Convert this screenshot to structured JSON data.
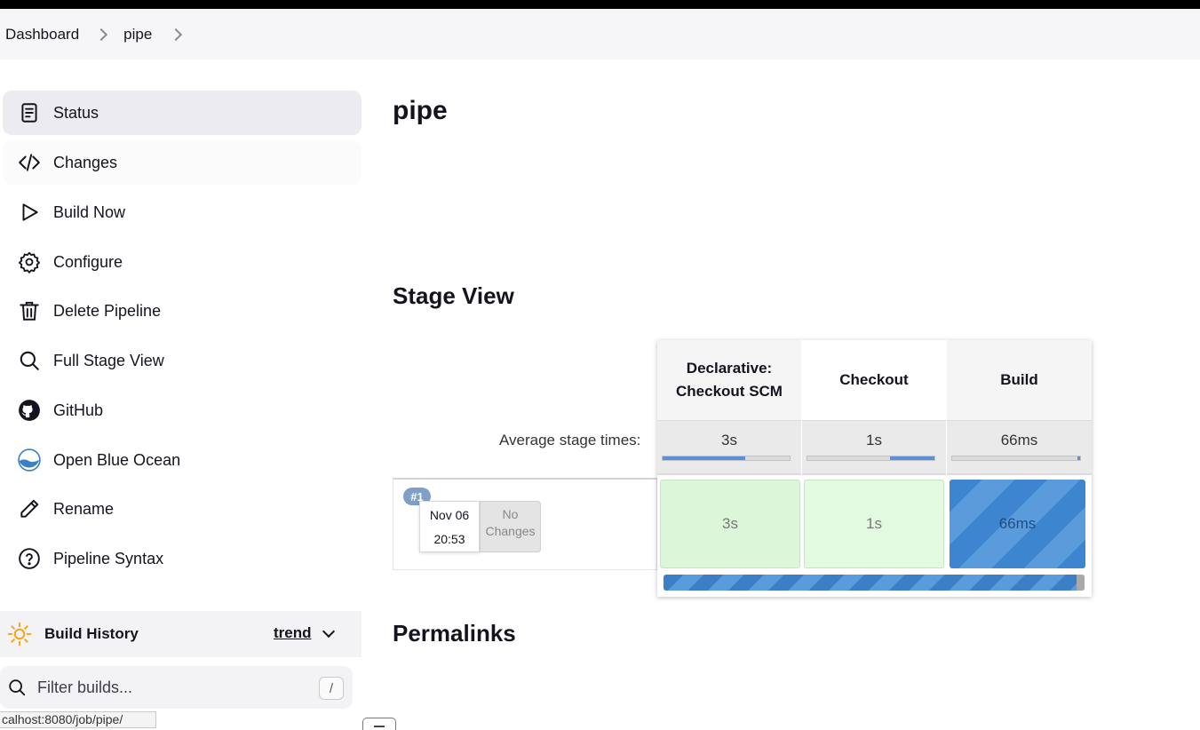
{
  "breadcrumb": {
    "items": [
      "Dashboard",
      "pipe"
    ]
  },
  "sidebar": {
    "items": [
      {
        "label": "Status",
        "icon": "document-icon"
      },
      {
        "label": "Changes",
        "icon": "code-icon"
      },
      {
        "label": "Build Now",
        "icon": "play-icon"
      },
      {
        "label": "Configure",
        "icon": "gear-icon"
      },
      {
        "label": "Delete Pipeline",
        "icon": "trash-icon"
      },
      {
        "label": "Full Stage View",
        "icon": "search-icon"
      },
      {
        "label": "GitHub",
        "icon": "github-icon"
      },
      {
        "label": "Open Blue Ocean",
        "icon": "blue-ocean-icon"
      },
      {
        "label": "Rename",
        "icon": "pencil-icon"
      },
      {
        "label": "Pipeline Syntax",
        "icon": "help-icon"
      }
    ]
  },
  "build_history": {
    "title": "Build History",
    "trend": "trend",
    "filter_placeholder": "Filter builds...",
    "shortcut": "/"
  },
  "status_url": "calhost:8080/job/pipe/",
  "main": {
    "title": "pipe",
    "stage_view_heading": "Stage View",
    "permalinks_heading": "Permalinks",
    "avg_label": "Average stage times:",
    "stages": [
      {
        "name_line1": "Declarative:",
        "name_line2": "Checkout SCM",
        "avg": "3s",
        "avg_fill": 0.65,
        "cell": "3s",
        "state": "success"
      },
      {
        "name_line1": "Checkout",
        "name_line2": "",
        "avg": "1s",
        "avg_fill": 0.35,
        "cell": "1s",
        "state": "success"
      },
      {
        "name_line1": "Build",
        "name_line2": "",
        "avg": "66ms",
        "avg_fill": 0.02,
        "cell": "66ms",
        "state": "running"
      }
    ],
    "run": {
      "number": "#1",
      "date": "Nov 06",
      "time": "20:53",
      "changes_line1": "No",
      "changes_line2": "Changes"
    }
  },
  "colors": {
    "accent": "#3d86cf",
    "success": "#dcf6d9",
    "badge": "#7f9fc6"
  }
}
